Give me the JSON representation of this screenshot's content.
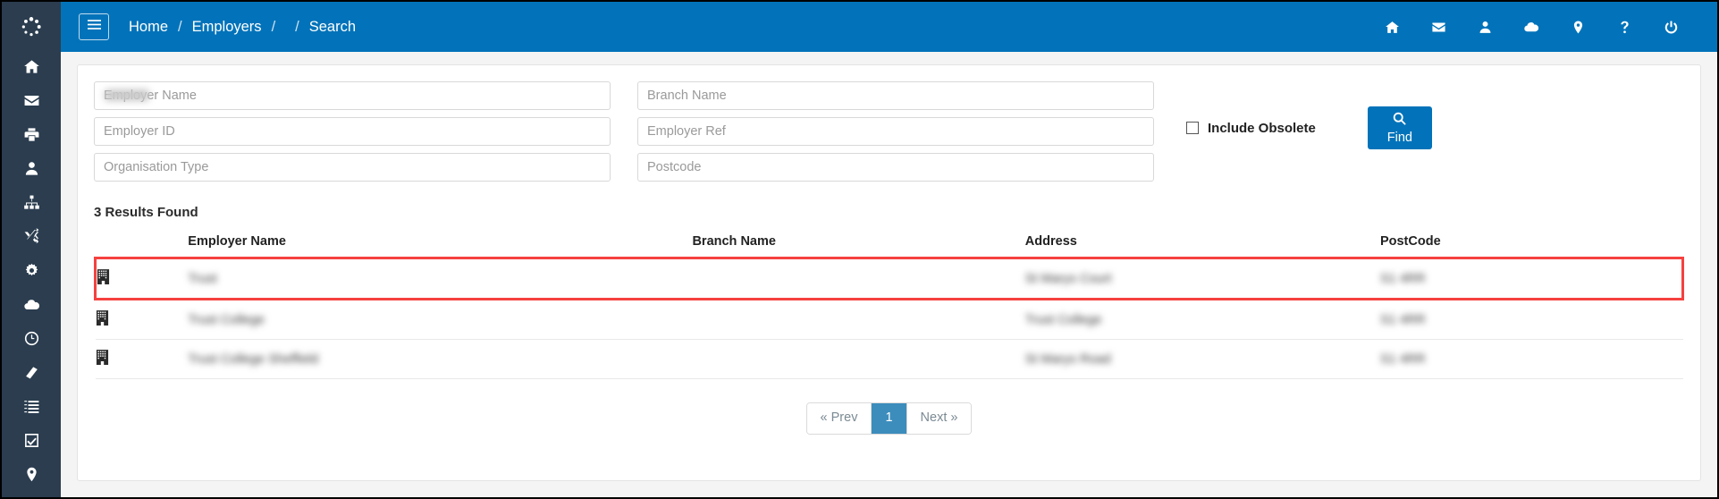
{
  "theme": {
    "sidebar_bg": "#2b3d4f",
    "topbar_bg": "#0273ba",
    "accent": "#0273ba",
    "highlight_border": "#f5413f",
    "pager_active": "#3c8dbc"
  },
  "sidebar": {
    "logo_icon": "spinner-icon",
    "items": [
      {
        "icon": "home-icon",
        "name": "sidebar-item-home"
      },
      {
        "icon": "envelope-icon",
        "name": "sidebar-item-mail"
      },
      {
        "icon": "printer-icon",
        "name": "sidebar-item-print"
      },
      {
        "icon": "user-icon",
        "name": "sidebar-item-user"
      },
      {
        "icon": "sitemap-icon",
        "name": "sidebar-item-sitemap"
      },
      {
        "icon": "shuffle-icon",
        "name": "sidebar-item-shuffle"
      },
      {
        "icon": "gear-icon",
        "name": "sidebar-item-settings"
      },
      {
        "icon": "cloud-icon",
        "name": "sidebar-item-cloud"
      },
      {
        "icon": "clock-icon",
        "name": "sidebar-item-clock"
      },
      {
        "icon": "book-icon",
        "name": "sidebar-item-book"
      },
      {
        "icon": "list-ol-icon",
        "name": "sidebar-item-list"
      },
      {
        "icon": "check-square-icon",
        "name": "sidebar-item-tasks"
      },
      {
        "icon": "map-pin-icon",
        "name": "sidebar-item-location"
      }
    ]
  },
  "topbar": {
    "menu_toggle_icon": "hamburger-icon",
    "breadcrumb": {
      "home": "Home",
      "sep1": "/",
      "employers": "Employers",
      "sep2": "/",
      "sep3": "/",
      "current": "Search"
    },
    "icons": [
      {
        "icon": "home-icon",
        "name": "topbar-home-icon"
      },
      {
        "icon": "envelope-icon",
        "name": "topbar-messages-icon"
      },
      {
        "icon": "user-icon",
        "name": "topbar-profile-icon"
      },
      {
        "icon": "cloud-icon",
        "name": "topbar-cloud-icon"
      },
      {
        "icon": "map-pin-icon",
        "name": "topbar-location-icon"
      },
      {
        "icon": "question-icon",
        "name": "topbar-help-icon"
      },
      {
        "icon": "power-icon",
        "name": "topbar-logout-icon"
      }
    ]
  },
  "search_form": {
    "employer_name": {
      "placeholder": "Employer Name",
      "value": "",
      "redacted": true
    },
    "employer_id": {
      "placeholder": "Employer ID",
      "value": ""
    },
    "organisation_type": {
      "placeholder": "Organisation Type",
      "value": ""
    },
    "branch_name": {
      "placeholder": "Branch Name",
      "value": ""
    },
    "employer_ref": {
      "placeholder": "Employer Ref",
      "value": ""
    },
    "postcode": {
      "placeholder": "Postcode",
      "value": ""
    },
    "include_obsolete": {
      "label": "Include Obsolete",
      "checked": false
    },
    "find_button": {
      "label": "Find",
      "icon": "search-icon"
    }
  },
  "results": {
    "count_label": "3 Results Found",
    "columns": [
      "",
      "Employer Name",
      "Branch Name",
      "Address",
      "PostCode"
    ],
    "rows": [
      {
        "icon": "building-icon",
        "employer_name": "Trust",
        "branch_name": "",
        "address": "St Marys Court",
        "postcode": "S1 4RR",
        "highlighted": true
      },
      {
        "icon": "building-icon",
        "employer_name": "Trust College",
        "branch_name": "",
        "address": "Trust College",
        "postcode": "S1 4RR",
        "highlighted": false
      },
      {
        "icon": "building-icon",
        "employer_name": "Trust College Sheffield",
        "branch_name": "",
        "address": "St Marys Road",
        "postcode": "S1 4RR",
        "highlighted": false
      }
    ]
  },
  "pagination": {
    "prev": "« Prev",
    "pages": [
      "1"
    ],
    "current_page": "1",
    "next": "Next »"
  }
}
